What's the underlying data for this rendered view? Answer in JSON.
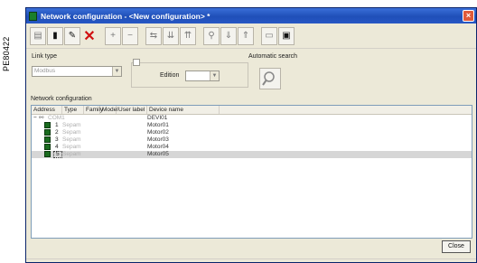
{
  "side_label": "PE80422",
  "window": {
    "title": "Network configuration - <New configuration> *",
    "close_glyph": "×"
  },
  "toolbar": {
    "buttons": [
      {
        "name": "new-icon",
        "glyph": "▭"
      },
      {
        "name": "delete-icon",
        "glyph": "✕"
      },
      {
        "name": "plus-icon",
        "glyph": "+"
      },
      {
        "name": "minus-icon",
        "glyph": "−"
      },
      {
        "name": "save-icon",
        "glyph": "▣"
      }
    ]
  },
  "link_type": {
    "label": "Link type",
    "value": "Modbus"
  },
  "edition": {
    "label": "Edition"
  },
  "automatic_search": {
    "label": "Automatic search"
  },
  "network": {
    "label": "Network configuration",
    "columns": [
      "Address",
      "Type",
      "Family",
      "Model",
      "User label",
      "Device name"
    ],
    "root": {
      "address": "COM1",
      "device_name": "DEVI01"
    },
    "rows": [
      {
        "num": "1",
        "type": "Sepam",
        "device_name": "Motor01",
        "selected": false
      },
      {
        "num": "2",
        "type": "Sepam",
        "device_name": "Motor02",
        "selected": false
      },
      {
        "num": "3",
        "type": "Sepam",
        "device_name": "Motor03",
        "selected": false
      },
      {
        "num": "4",
        "type": "Sepam",
        "device_name": "Motor04",
        "selected": false
      },
      {
        "num": "5",
        "type": "Sepam",
        "device_name": "Motor05",
        "selected": true
      }
    ]
  },
  "close_button": "Close",
  "colors": {
    "titlebar": "#2757c4",
    "device_icon": "#1a6b1f",
    "selection": "#d6d6d6"
  }
}
